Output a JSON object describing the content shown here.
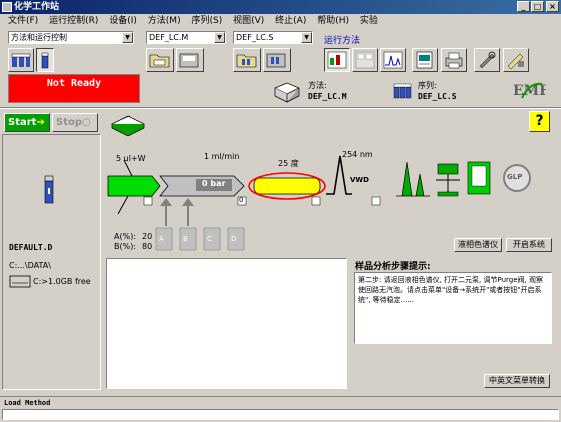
{
  "window": {
    "title": "化学工作站",
    "min_label": "_",
    "max_label": "□",
    "close_label": "×"
  },
  "menu": [
    {
      "label": "文件(F)"
    },
    {
      "label": "运行控制(R)"
    },
    {
      "label": "设备(I)"
    },
    {
      "label": "方法(M)"
    },
    {
      "label": "序列(S)"
    },
    {
      "label": "视图(V)"
    },
    {
      "label": "终止(A)"
    },
    {
      "label": "帮助(H)"
    },
    {
      "label": "实验"
    }
  ],
  "toolbar": {
    "view_combo": "方法和运行控制",
    "method_combo": "DEF_LC.M",
    "sequence_combo": "DEF_LC.S",
    "run_method_link": "运行方法"
  },
  "status": {
    "state": "Not Ready",
    "method_label": "方法:",
    "method_value": "DEF_LC.M",
    "sequence_label": "序列:",
    "sequence_value": "DEF_LC.S"
  },
  "controls": {
    "start_label": "Start",
    "stop_label": "Stop",
    "help_label": "?"
  },
  "diagram": {
    "injector_volume": "5 ul+W",
    "flow_rate": "1 ml/min",
    "pressure": "0 bar",
    "temperature": "25 度",
    "wavelength": "254 nm",
    "detector_label": "VWD",
    "pump_indicator": "0",
    "glp_label": "GLP",
    "a_label": "A(%):",
    "a_value": "20",
    "b_label": "B(%):",
    "b_value": "80",
    "bottles": [
      "A",
      "B",
      "C",
      "D"
    ]
  },
  "left_panel": {
    "sample_name": "DEFAULT.D",
    "data_path": "C:...\\DATA\\",
    "disk_free": "C:>1.0GB free"
  },
  "buttons": {
    "lc_diagram": "液相色谱仪",
    "start_system": "开启系统",
    "language_toggle": "中英文菜单转换"
  },
  "hint": {
    "title": "样品分析步骤提示:",
    "text": "第二步: 请返回液相色谱仪, 打开二元泵, 调节Purge阀, 观察使回路无汽泡。请点击菜单\"设备→系统开\"或者按钮\"开启系统\", 等待稳定......"
  },
  "statusbar": {
    "text": "Load Method"
  },
  "colors": {
    "status_red": "#ff0000",
    "title_blue": "#0a246a",
    "flow_green": "#00cc00",
    "column_yellow": "#ffff00"
  }
}
